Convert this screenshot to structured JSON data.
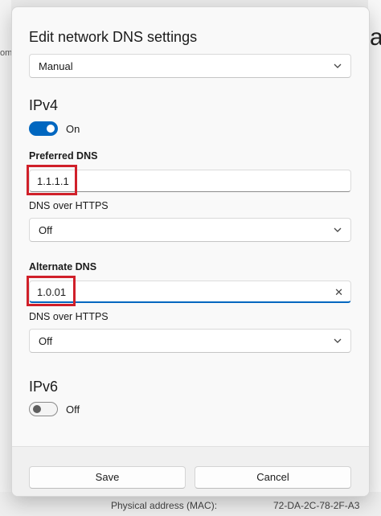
{
  "background": {
    "left_fragment": "om",
    "right_fragment": "av",
    "bottom_label": "Physical address (MAC):",
    "bottom_value": "72-DA-2C-78-2F-A3"
  },
  "dialog": {
    "title": "Edit network DNS settings",
    "mode_select": "Manual",
    "ipv4": {
      "heading": "IPv4",
      "toggle_state": "On",
      "preferred_label": "Preferred DNS",
      "preferred_value": "1.1.1.1",
      "preferred_doh_label": "DNS over HTTPS",
      "preferred_doh_value": "Off",
      "alternate_label": "Alternate DNS",
      "alternate_value": "1.0.01",
      "alternate_doh_label": "DNS over HTTPS",
      "alternate_doh_value": "Off"
    },
    "ipv6": {
      "heading": "IPv6",
      "toggle_state": "Off"
    },
    "save_label": "Save",
    "cancel_label": "Cancel"
  },
  "colors": {
    "accent": "#0067c0",
    "highlight": "#d0202a"
  }
}
